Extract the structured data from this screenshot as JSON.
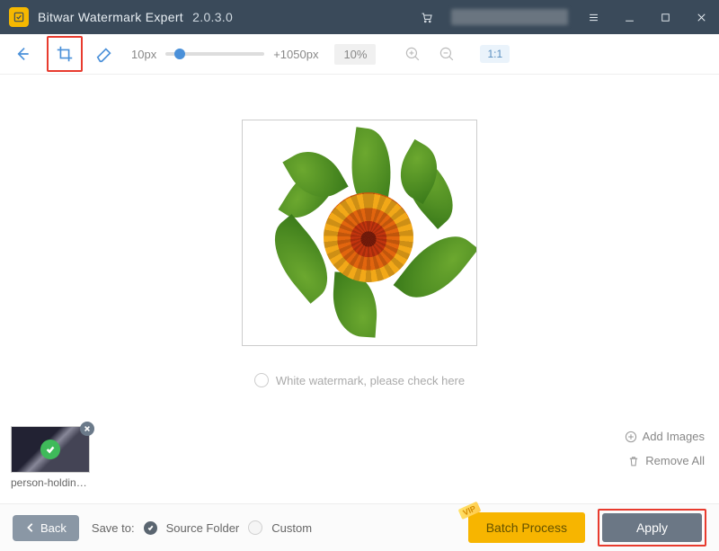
{
  "titlebar": {
    "app_name": "Bitwar Watermark Expert",
    "version": "2.0.3.0"
  },
  "toolbar": {
    "size_min_label": "10px",
    "size_max_label": "+1050px",
    "zoom_label": "10%",
    "ratio_label": "1:1"
  },
  "canvas": {
    "hint": "White watermark, please check here"
  },
  "thumbs": {
    "items": [
      {
        "label": "person-holding-fil..."
      }
    ],
    "add_label": "Add Images",
    "remove_label": "Remove All"
  },
  "footer": {
    "back_label": "Back",
    "save_to_label": "Save to:",
    "source_folder_label": "Source Folder",
    "custom_label": "Custom",
    "vip_label": "VIP",
    "batch_label": "Batch Process",
    "apply_label": "Apply"
  }
}
